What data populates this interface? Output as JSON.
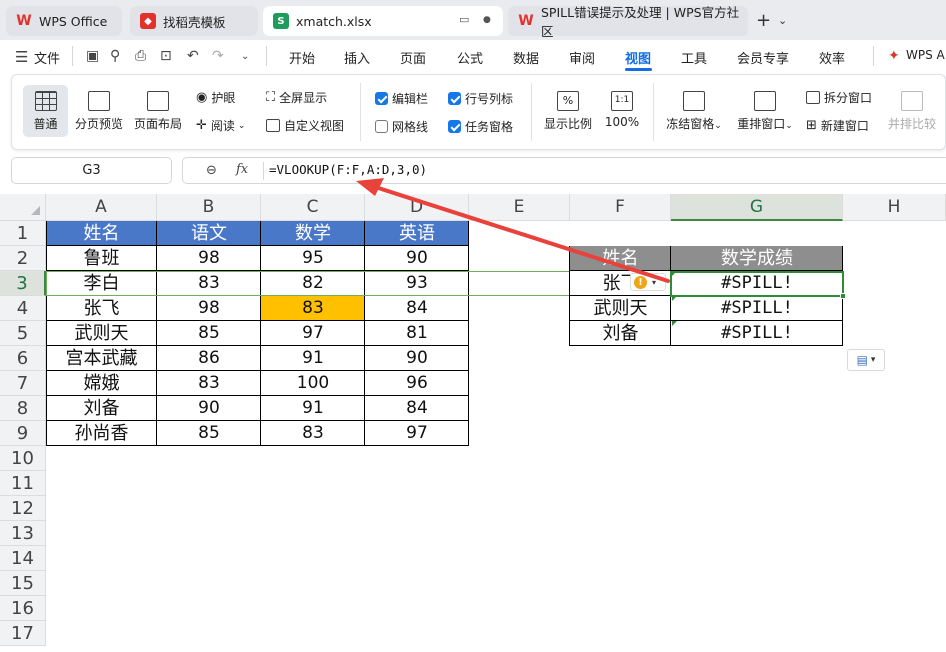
{
  "tabs": [
    {
      "label": "WPS Office",
      "icon": "wps-logo-icon"
    },
    {
      "label": "找稻壳模板",
      "icon": "docer-icon"
    },
    {
      "label": "xmatch.xlsx",
      "icon": "spreadsheet-icon"
    },
    {
      "label": "SPILL错误提示及处理 | WPS官方社区",
      "icon": "wps-logo-icon"
    }
  ],
  "menu": {
    "file": "文件",
    "items": [
      "开始",
      "插入",
      "页面",
      "公式",
      "数据",
      "审阅",
      "视图",
      "工具",
      "会员专享",
      "效率"
    ],
    "active": "视图",
    "wps_ai": "WPS A"
  },
  "ribbon": {
    "normal": "普通",
    "page_break_preview": "分页预览",
    "page_layout": "页面布局",
    "eye_care": "护眼",
    "reading": "阅读",
    "full_screen": "全屏显示",
    "custom_view": "自定义视图",
    "formula_bar": "编辑栏",
    "gridlines": "网格线",
    "headings": "行号列标",
    "task_pane": "任务窗格",
    "zoom": "显示比例",
    "zoom_100": "100%",
    "freeze_panes": "冻结窗格",
    "arrange": "重排窗口",
    "split": "拆分窗口",
    "new_window": "新建窗口",
    "side_by_side": "并排比较",
    "checkbox_states": {
      "formula_bar": true,
      "gridlines": false,
      "headings": true,
      "task_pane": true
    }
  },
  "formula_bar": {
    "name_box": "G3",
    "formula": "=VLOOKUP(F:F,A:D,3,0)"
  },
  "columns": [
    "A",
    "B",
    "C",
    "D",
    "E",
    "F",
    "G",
    "H"
  ],
  "rows": [
    "1",
    "2",
    "3",
    "4",
    "5",
    "6",
    "7",
    "8",
    "9",
    "10",
    "11",
    "12",
    "13",
    "14",
    "15",
    "16",
    "17"
  ],
  "table1": {
    "headers": [
      "姓名",
      "语文",
      "数学",
      "英语"
    ],
    "rows": [
      [
        "鲁班",
        "98",
        "95",
        "90"
      ],
      [
        "李白",
        "83",
        "82",
        "93"
      ],
      [
        "张飞",
        "98",
        "83",
        "84"
      ],
      [
        "武则天",
        "85",
        "97",
        "81"
      ],
      [
        "宫本武藏",
        "86",
        "91",
        "90"
      ],
      [
        "嫦娥",
        "83",
        "100",
        "96"
      ],
      [
        "刘备",
        "90",
        "91",
        "84"
      ],
      [
        "孙尚香",
        "85",
        "83",
        "97"
      ]
    ]
  },
  "table2": {
    "headers": [
      "姓名",
      "数学成绩"
    ],
    "rows": [
      [
        "张飞",
        "#SPILL!"
      ],
      [
        "武则天",
        "#SPILL!"
      ],
      [
        "刘备",
        "#SPILL!"
      ]
    ]
  },
  "colors": {
    "header_blue": "#4a78c9",
    "header_grey": "#8e8e8e",
    "highlight": "#ffc000",
    "selection_green": "#2f8a3a",
    "arrow_red": "#e8423a",
    "accent": "#136ee2"
  }
}
